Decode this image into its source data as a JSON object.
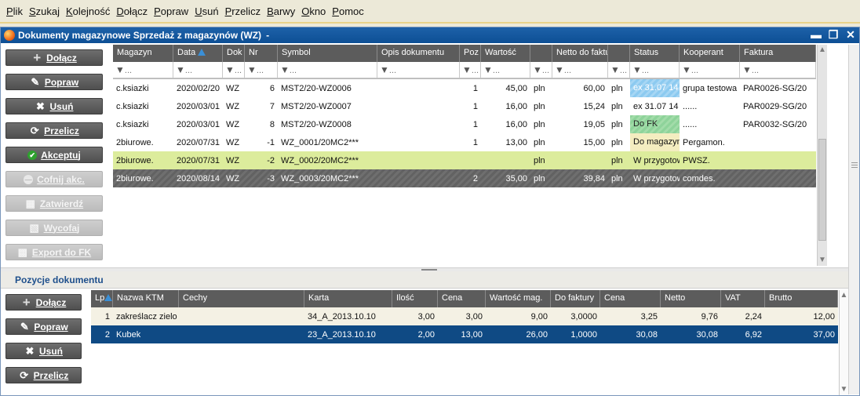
{
  "menu": [
    "Plik",
    "Szukaj",
    "Kolejność",
    "Dołącz",
    "Popraw",
    "Usuń",
    "Przelicz",
    "Barwy",
    "Okno",
    "Pomoc"
  ],
  "window": {
    "title": "Dokumenty magazynowe Sprzedaż z magazynów (WZ)",
    "title_suffix": "-"
  },
  "upper_buttons": [
    "Dołącz",
    "Popraw",
    "Usuń",
    "Przelicz",
    "Akceptuj",
    "Cofnij akc.",
    "Zatwierdź",
    "Wycofaj",
    "Export do FK"
  ],
  "upper_grid": {
    "columns": [
      "Magazyn",
      "Data",
      "Dok",
      "Nr",
      "Symbol",
      "Opis dokumentu",
      "Poz",
      "Wartość",
      "",
      "Netto do faktu",
      "",
      "Status",
      "Kooperant",
      "Faktura"
    ],
    "filter_text": "...",
    "rows": [
      [
        "c.ksiazki",
        "2020/02/20",
        "WZ",
        "6",
        "MST2/20-WZ0006",
        "",
        "1",
        "45,00",
        "pln",
        "60,00",
        "pln",
        "ex 31.07 14",
        "grupa testowa",
        "PAR0026-SG/20"
      ],
      [
        "c.ksiazki",
        "2020/03/01",
        "WZ",
        "7",
        "MST2/20-WZ0007",
        "",
        "1",
        "16,00",
        "pln",
        "15,24",
        "pln",
        "ex 31.07 14",
        "......",
        "PAR0029-SG/20"
      ],
      [
        "c.ksiazki",
        "2020/03/01",
        "WZ",
        "8",
        "MST2/20-WZ0008",
        "",
        "1",
        "16,00",
        "pln",
        "19,05",
        "pln",
        "Do FK",
        "......",
        "PAR0032-SG/20"
      ],
      [
        "2biurowe.",
        "2020/07/31",
        "WZ",
        "-1",
        "WZ_0001/20MC2***",
        "",
        "1",
        "13,00",
        "pln",
        "15,00",
        "pln",
        "Do magazyn",
        "Pergamon.",
        ""
      ],
      [
        "2biurowe.",
        "2020/07/31",
        "WZ",
        "-2",
        "WZ_0002/20MC2***",
        "",
        "",
        "",
        "pln",
        "",
        "pln",
        "W przygotow",
        "PWSZ.",
        ""
      ],
      [
        "2biurowe.",
        "2020/08/14",
        "WZ",
        "-3",
        "WZ_0003/20MC2***",
        "",
        "2",
        "35,00",
        "pln",
        "39,84",
        "pln",
        "W przygotow",
        "comdes.",
        ""
      ]
    ]
  },
  "lower_section": {
    "title": "Pozycje dokumentu",
    "buttons": [
      "Dołącz",
      "Popraw",
      "Usuń",
      "Przelicz"
    ],
    "columns": [
      "Lp",
      "Nazwa KTM",
      "Cechy",
      "Karta",
      "Ilość",
      "Cena",
      "Wartość mag.",
      "Do faktury",
      "Cena",
      "Netto",
      "VAT",
      "Brutto"
    ],
    "rows": [
      [
        "1",
        "zakreślacz zielo",
        "",
        "34_A_2013.10.10",
        "3,00",
        "3,00",
        "9,00",
        "3,0000",
        "3,25",
        "9,76",
        "2,24",
        "12,00"
      ],
      [
        "2",
        "Kubek",
        "",
        "23_A_2013.10.10",
        "2,00",
        "13,00",
        "26,00",
        "1,0000",
        "30,08",
        "30,08",
        "6,92",
        "37,00"
      ]
    ]
  },
  "colors": {
    "titlebar": "#0d4f95",
    "button": "#5a5a5a",
    "header": "#5c5c5c",
    "row_yellow": "#dcec9c",
    "row_selected": "#666666",
    "lower_selected": "#0f4a84"
  }
}
